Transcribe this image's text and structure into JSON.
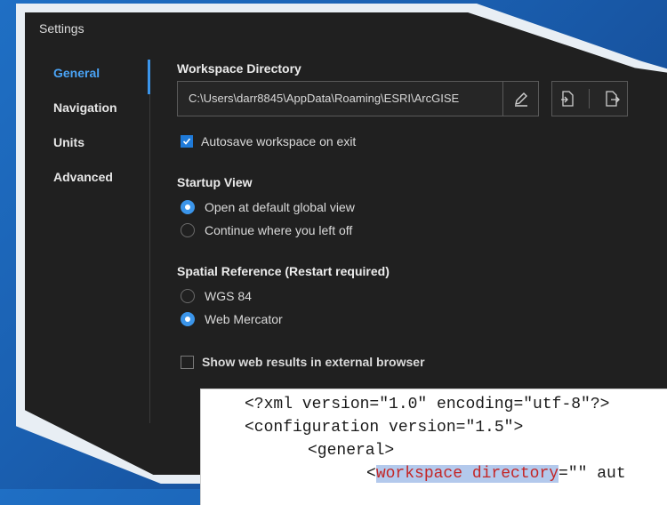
{
  "window": {
    "title": "Settings"
  },
  "nav": {
    "items": [
      {
        "label": "General",
        "active": true
      },
      {
        "label": "Navigation",
        "active": false
      },
      {
        "label": "Units",
        "active": false
      },
      {
        "label": "Advanced",
        "active": false
      }
    ]
  },
  "general": {
    "workspace": {
      "heading": "Workspace Directory",
      "path": "C:\\Users\\darr8845\\AppData\\Roaming\\ESRI\\ArcGISE",
      "autosave_label": "Autosave workspace on exit",
      "autosave_checked": true
    },
    "startup": {
      "heading": "Startup View",
      "options": [
        {
          "label": "Open at default global view",
          "selected": true
        },
        {
          "label": "Continue where you left off",
          "selected": false
        }
      ]
    },
    "spatial": {
      "heading": "Spatial Reference (Restart required)",
      "options": [
        {
          "label": "WGS 84",
          "selected": false
        },
        {
          "label": "Web Mercator",
          "selected": true
        }
      ]
    },
    "web_results": {
      "label": "Show web results in external browser",
      "checked": false
    }
  },
  "xml": {
    "line1": "<?xml version=\"1.0\" encoding=\"utf-8\"?>",
    "line2": "<configuration version=\"1.5\">",
    "line3": "<general>",
    "line4_prefix": "<",
    "line4_highlight": "workspace directory",
    "line4_suffix": "=\"\" aut"
  },
  "colors": {
    "accent": "#3b95ea",
    "background": "#202020",
    "highlight": "#b3c9ec"
  }
}
